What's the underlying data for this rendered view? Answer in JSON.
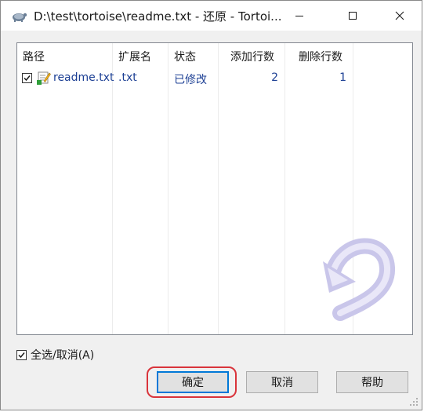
{
  "window": {
    "title": "D:\\test\\tortoise\\readme.txt - 还原 - Tortoi..."
  },
  "list": {
    "columns": [
      "路径",
      "扩展名",
      "状态",
      "添加行数",
      "删除行数"
    ],
    "rows": [
      {
        "checked": true,
        "path": "readme.txt",
        "ext": ".txt",
        "status": "已修改",
        "added": "2",
        "deleted": "1"
      }
    ]
  },
  "select_all": {
    "label": "全选/取消(A)",
    "checked": true
  },
  "buttons": {
    "ok": "确定",
    "cancel": "取消",
    "help": "帮助"
  },
  "colors": {
    "item_text": "#1c3f94",
    "highlight_ring": "#d9343b",
    "focus_border": "#0078d7"
  },
  "icons": {
    "app": "tortoise-icon",
    "file": "text-file-modified-icon",
    "watermark": "revert-arrow-icon"
  }
}
